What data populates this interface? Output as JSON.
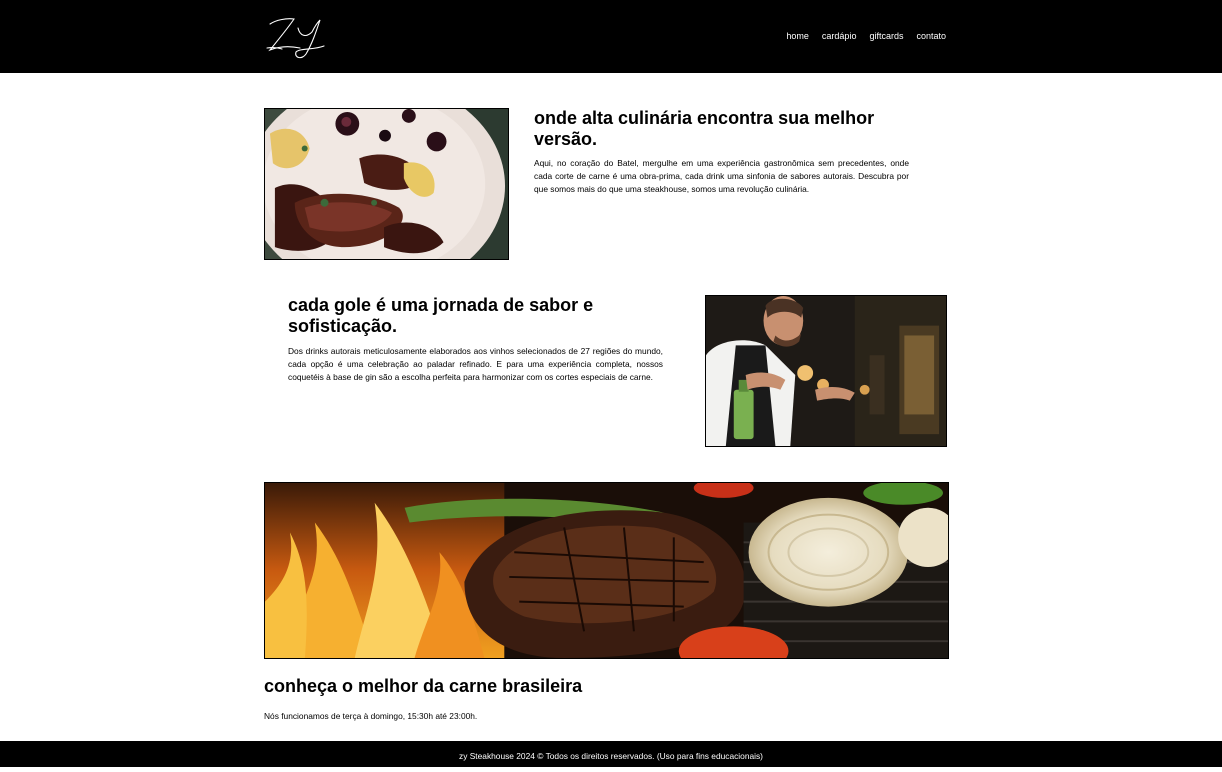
{
  "header": {
    "logo_text": "ZY",
    "nav": [
      {
        "label": "home"
      },
      {
        "label": "cardápio"
      },
      {
        "label": "giftcards"
      },
      {
        "label": "contato"
      }
    ]
  },
  "sections": [
    {
      "title": "onde alta culinária encontra sua melhor versão.",
      "text": "Aqui, no coração do Batel, mergulhe em uma experiência gastronômica sem precedentes, onde cada corte de carne é uma obra-prima, cada drink uma sinfonia de sabores autorais. Descubra por que somos mais do que uma steakhouse, somos uma revolução culinária."
    },
    {
      "title": "cada gole é uma jornada de sabor e sofisticação.",
      "text": "Dos drinks autorais meticulosamente elaborados aos vinhos selecionados de 27 regiões do mundo, cada opção é uma celebração ao paladar refinado. E para uma experiência completa, nossos coquetéis à base de gin são a escolha perfeita para harmonizar com os cortes especiais de carne."
    },
    {
      "title": "conheça o melhor da carne brasileira",
      "text": "Nós funcionamos de terça à domingo, 15:30h até 23:00h."
    }
  ],
  "footer": {
    "text": "zy Steakhouse 2024 © Todos os direitos reservados. (Uso para fins educacionais)"
  },
  "colors": {
    "header_bg": "#000000",
    "footer_bg": "#000000",
    "page_bg": "#ffffff"
  }
}
